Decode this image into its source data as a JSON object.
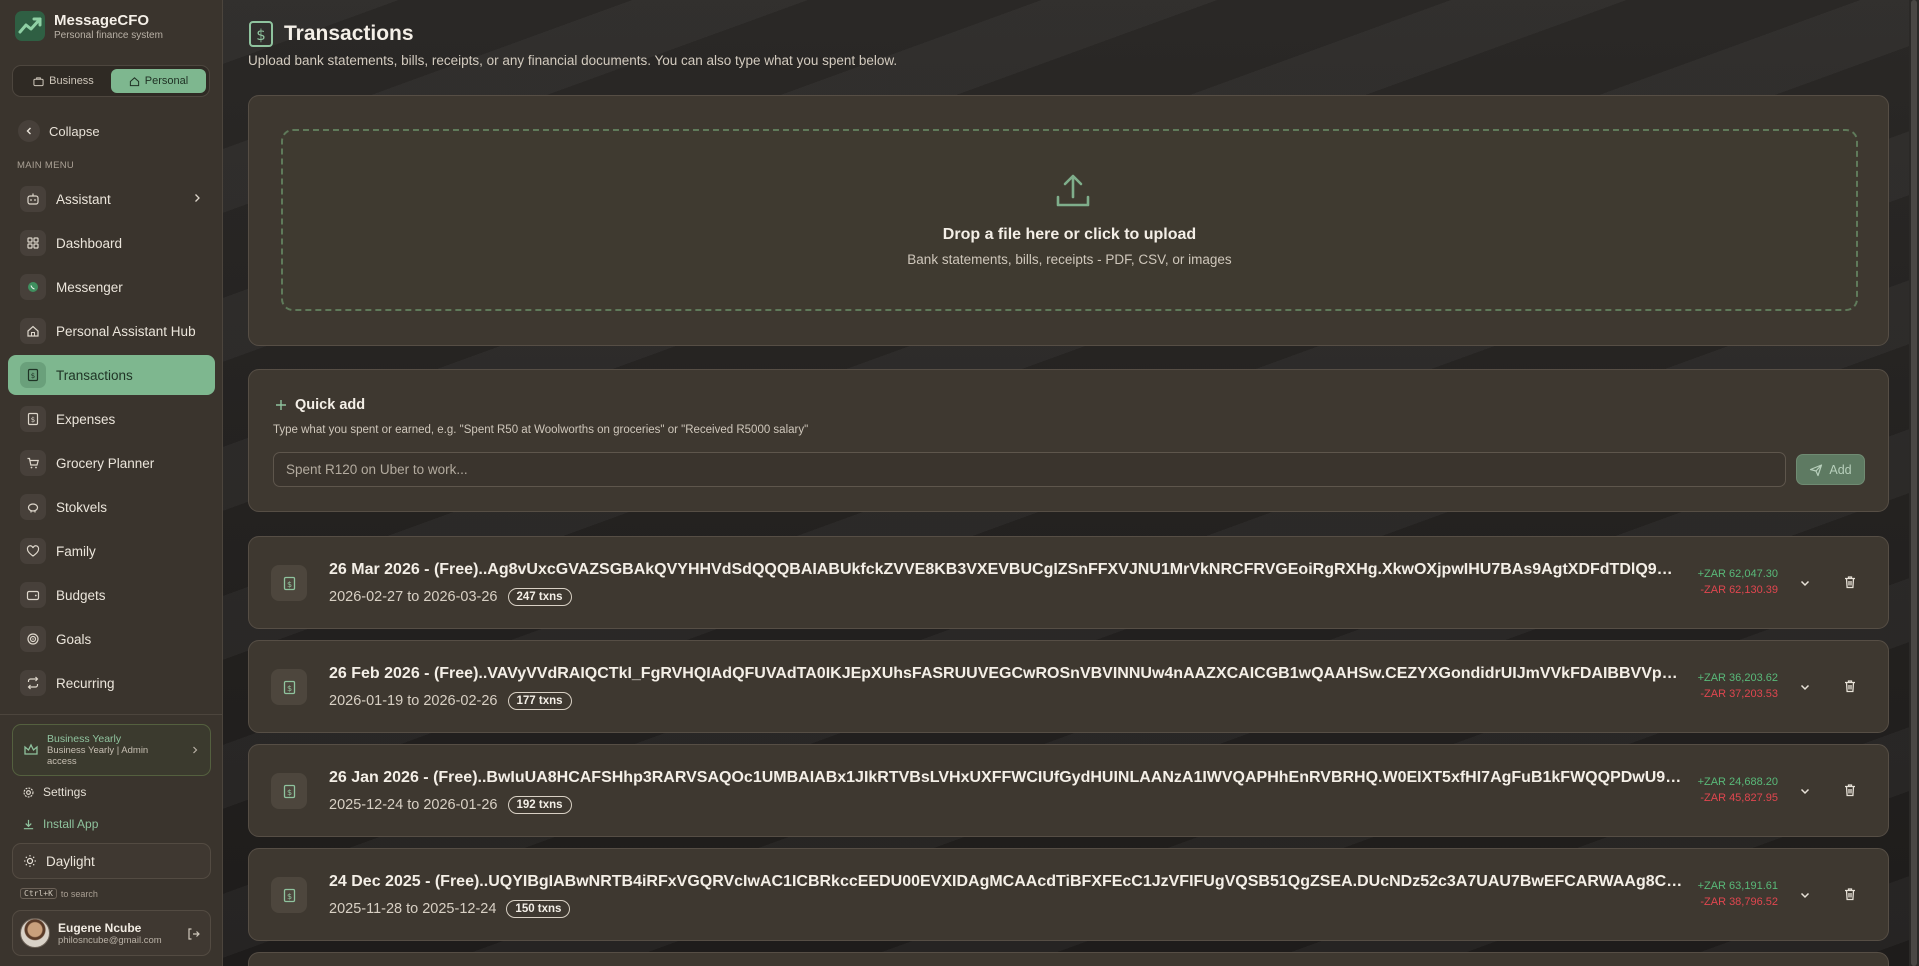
{
  "app": {
    "name": "MessageCFO",
    "tagline": "Personal finance system"
  },
  "mode_switch": {
    "business_label": "Business",
    "personal_label": "Personal",
    "active": "Personal"
  },
  "sidebar": {
    "collapse_label": "Collapse",
    "menu_caption": "MAIN MENU",
    "items": [
      {
        "label": "Assistant",
        "icon": "robot-icon",
        "has_submenu": true
      },
      {
        "label": "Dashboard",
        "icon": "grid-icon"
      },
      {
        "label": "Messenger",
        "icon": "whatsapp-icon"
      },
      {
        "label": "Personal Assistant Hub",
        "icon": "home-icon"
      },
      {
        "label": "Transactions",
        "icon": "dollar-doc-icon",
        "active": true
      },
      {
        "label": "Expenses",
        "icon": "receipt-icon"
      },
      {
        "label": "Grocery Planner",
        "icon": "cart-icon"
      },
      {
        "label": "Stokvels",
        "icon": "piggy-bank-icon"
      },
      {
        "label": "Family",
        "icon": "heart-icon"
      },
      {
        "label": "Budgets",
        "icon": "wallet-icon"
      },
      {
        "label": "Goals",
        "icon": "target-icon"
      },
      {
        "label": "Recurring",
        "icon": "repeat-icon"
      }
    ],
    "plan": {
      "title": "Business Yearly",
      "subtitle": "Business Yearly | Admin access"
    },
    "settings_label": "Settings",
    "install_label": "Install App",
    "theme_label": "Daylight",
    "search_hint": {
      "key": "Ctrl+K",
      "text": "to search"
    },
    "user": {
      "name": "Eugene Ncube",
      "email": "philosncube@gmail.com"
    }
  },
  "page": {
    "title": "Transactions",
    "subtitle": "Upload bank statements, bills, receipts, or any financial documents. You can also type what you spent below."
  },
  "upload": {
    "title": "Drop a file here or click to upload",
    "subtitle": "Bank statements, bills, receipts - PDF, CSV, or images"
  },
  "quick_add": {
    "title": "Quick add",
    "hint": "Type what you spent or earned, e.g. \"Spent R50 at Woolworths on groceries\" or \"Received R5000 salary\"",
    "placeholder": "Spent R120 on Uber to work...",
    "button_label": "Add"
  },
  "statements": [
    {
      "title": "26 Mar 2026 - (Free)..Ag8vUxcGVAZSGBAkQVYHHVdSdQQQBAIABUkfckZVVE8KB3VXEVBUCgIZSnFFXVJNU1MrVkNRCFRVGEoiRgRXHg.XkwOXjpwIHU7BAs9AgtXDFdTDlQ9BglCA1Q...",
      "range": "2026-02-27 to 2026-03-26",
      "count": "247 txns",
      "amount_in": "+ZAR 62,047.30",
      "amount_out": "-ZAR 62,130.39"
    },
    {
      "title": "26 Feb 2026 - (Free)..VAVyVVdRAIQCTkI_FgRVHQIAdQFUVAdTA0IKJEpXUhsFASRUUVEGCwROSnVBVINNUw4nAAZXCAICGB1wQAAHSw.CEZYXGondidrUIJmVVkFDAIBBVVpVgdRBVR...",
      "range": "2026-01-19 to 2026-02-26",
      "count": "177 txns",
      "amount_in": "+ZAR 36,203.62",
      "amount_out": "-ZAR 37,203.53"
    },
    {
      "title": "26 Jan 2026 - (Free)..BwIuUA8HCAFSHhp3RARVSAQOc1UMBAIABx1JIkRTVBsLVHxUXFFWCIUfGydHUINLAANzA1IWVQAPHhEnRVBRHQ.W0EIXT5xfHI7AgFuB1kFWQQPDwU9BgICAQB...",
      "range": "2025-12-24 to 2026-01-26",
      "count": "192 txns",
      "amount_in": "+ZAR 24,688.20",
      "amount_out": "-ZAR 45,827.95"
    },
    {
      "title": "24 Dec 2025 - (Free)..UQYIBgIABwNRTB4iRFxVGQRVcIwAC1ICBRkccEEDU00EVXIDAgMCAAcdTiBFXFEcC1JzVFIFUgVQSB51QgZSEA.DUcNDz52c3A7UAU7BwEFCARWAAg8CVIAAAQE...",
      "range": "2025-11-28 to 2025-12-24",
      "count": "150 txns",
      "amount_in": "+ZAR 63,191.61",
      "amount_out": "-ZAR 38,796.52"
    }
  ]
}
